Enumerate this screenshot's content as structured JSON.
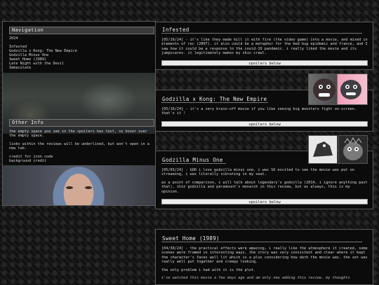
{
  "sidebar": {
    "nav_title": "Navigation",
    "nav_items": [
      "2024",
      "",
      "Infested",
      "Godzilla x Kong: The New Empire",
      "Godzilla Minus One",
      "Sweet Home (1989)",
      "Late Night with the Devil",
      "Immaculate"
    ],
    "info_title": "Other Info",
    "info_paragraphs": [
      "the empty space you see in the spoilers has text, so hover over the empty space.",
      "links within the reviews will be underlined, but won't open in a new tab.",
      "credit for icon code\nbackground credit"
    ]
  },
  "reviews": [
    {
      "title": "Infested",
      "paragraphs": [
        "[05/16/24] - it's like they made kill it with fire (the video game) into a movie, and mixed in elements of rec (2007). it also could be a metaphor for the bed bug epidemic and france, and I saw how it could be a response to the covid-19 pandemic. i really liked the movie and its jumpscares. it legitimately makes my skin crawl."
      ],
      "spoilers": "spoilers below"
    },
    {
      "title": "Godzilla x Kong: The New Empire",
      "paragraphs": [
        "[05/16/24] - it's a very brain-off movie if you like seeing big monsters fight on-screen. that's it !"
      ],
      "spoilers": "spoilers below"
    },
    {
      "title": "Godzilla Minus One",
      "paragraphs": [
        "[05/03/24] - GOD i love godzilla minus one. i was SO excited to see the movie was put on streaming, i was literally vibrating in my seat.",
        "as a point of comparison, i will talk about legendary's godzilla (2014, i ignore anything past that), shin godzilla and paramount's monarch in this review, but as always, this is my opinion."
      ],
      "spoilers": "spoilers below"
    },
    {
      "title": "Sweet Home (1989)",
      "paragraphs": [
        "[04/30/24] - the practical effects were amazing, i really like the atmosphere it created, some scenes were framed in interesting ways, the story was very consistent and clear where it kept the character's faces well lit which is a plus considering how dark the movie was. the set was really well put together and creepy looking.",
        "the only problem i had with it is the plot.",
        "i've watched this movie a few days ago and am only now adding this review. my thoughts"
      ]
    }
  ],
  "colors": {
    "panel_bg": "#0b0b0b",
    "bar_bg": "#3a3a3a",
    "button_bg": "#ececec",
    "text": "#d8d8d8"
  }
}
